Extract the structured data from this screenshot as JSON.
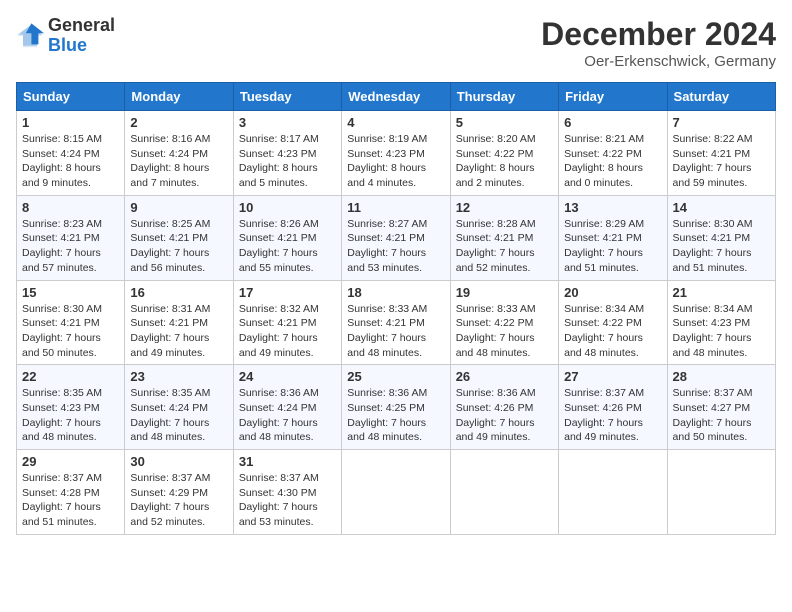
{
  "logo": {
    "general": "General",
    "blue": "Blue"
  },
  "title": "December 2024",
  "subtitle": "Oer-Erkenschwick, Germany",
  "headers": [
    "Sunday",
    "Monday",
    "Tuesday",
    "Wednesday",
    "Thursday",
    "Friday",
    "Saturday"
  ],
  "weeks": [
    [
      {
        "day": "1",
        "info": "Sunrise: 8:15 AM\nSunset: 4:24 PM\nDaylight: 8 hours and 9 minutes."
      },
      {
        "day": "2",
        "info": "Sunrise: 8:16 AM\nSunset: 4:24 PM\nDaylight: 8 hours and 7 minutes."
      },
      {
        "day": "3",
        "info": "Sunrise: 8:17 AM\nSunset: 4:23 PM\nDaylight: 8 hours and 5 minutes."
      },
      {
        "day": "4",
        "info": "Sunrise: 8:19 AM\nSunset: 4:23 PM\nDaylight: 8 hours and 4 minutes."
      },
      {
        "day": "5",
        "info": "Sunrise: 8:20 AM\nSunset: 4:22 PM\nDaylight: 8 hours and 2 minutes."
      },
      {
        "day": "6",
        "info": "Sunrise: 8:21 AM\nSunset: 4:22 PM\nDaylight: 8 hours and 0 minutes."
      },
      {
        "day": "7",
        "info": "Sunrise: 8:22 AM\nSunset: 4:21 PM\nDaylight: 7 hours and 59 minutes."
      }
    ],
    [
      {
        "day": "8",
        "info": "Sunrise: 8:23 AM\nSunset: 4:21 PM\nDaylight: 7 hours and 57 minutes."
      },
      {
        "day": "9",
        "info": "Sunrise: 8:25 AM\nSunset: 4:21 PM\nDaylight: 7 hours and 56 minutes."
      },
      {
        "day": "10",
        "info": "Sunrise: 8:26 AM\nSunset: 4:21 PM\nDaylight: 7 hours and 55 minutes."
      },
      {
        "day": "11",
        "info": "Sunrise: 8:27 AM\nSunset: 4:21 PM\nDaylight: 7 hours and 53 minutes."
      },
      {
        "day": "12",
        "info": "Sunrise: 8:28 AM\nSunset: 4:21 PM\nDaylight: 7 hours and 52 minutes."
      },
      {
        "day": "13",
        "info": "Sunrise: 8:29 AM\nSunset: 4:21 PM\nDaylight: 7 hours and 51 minutes."
      },
      {
        "day": "14",
        "info": "Sunrise: 8:30 AM\nSunset: 4:21 PM\nDaylight: 7 hours and 51 minutes."
      }
    ],
    [
      {
        "day": "15",
        "info": "Sunrise: 8:30 AM\nSunset: 4:21 PM\nDaylight: 7 hours and 50 minutes."
      },
      {
        "day": "16",
        "info": "Sunrise: 8:31 AM\nSunset: 4:21 PM\nDaylight: 7 hours and 49 minutes."
      },
      {
        "day": "17",
        "info": "Sunrise: 8:32 AM\nSunset: 4:21 PM\nDaylight: 7 hours and 49 minutes."
      },
      {
        "day": "18",
        "info": "Sunrise: 8:33 AM\nSunset: 4:21 PM\nDaylight: 7 hours and 48 minutes."
      },
      {
        "day": "19",
        "info": "Sunrise: 8:33 AM\nSunset: 4:22 PM\nDaylight: 7 hours and 48 minutes."
      },
      {
        "day": "20",
        "info": "Sunrise: 8:34 AM\nSunset: 4:22 PM\nDaylight: 7 hours and 48 minutes."
      },
      {
        "day": "21",
        "info": "Sunrise: 8:34 AM\nSunset: 4:23 PM\nDaylight: 7 hours and 48 minutes."
      }
    ],
    [
      {
        "day": "22",
        "info": "Sunrise: 8:35 AM\nSunset: 4:23 PM\nDaylight: 7 hours and 48 minutes."
      },
      {
        "day": "23",
        "info": "Sunrise: 8:35 AM\nSunset: 4:24 PM\nDaylight: 7 hours and 48 minutes."
      },
      {
        "day": "24",
        "info": "Sunrise: 8:36 AM\nSunset: 4:24 PM\nDaylight: 7 hours and 48 minutes."
      },
      {
        "day": "25",
        "info": "Sunrise: 8:36 AM\nSunset: 4:25 PM\nDaylight: 7 hours and 48 minutes."
      },
      {
        "day": "26",
        "info": "Sunrise: 8:36 AM\nSunset: 4:26 PM\nDaylight: 7 hours and 49 minutes."
      },
      {
        "day": "27",
        "info": "Sunrise: 8:37 AM\nSunset: 4:26 PM\nDaylight: 7 hours and 49 minutes."
      },
      {
        "day": "28",
        "info": "Sunrise: 8:37 AM\nSunset: 4:27 PM\nDaylight: 7 hours and 50 minutes."
      }
    ],
    [
      {
        "day": "29",
        "info": "Sunrise: 8:37 AM\nSunset: 4:28 PM\nDaylight: 7 hours and 51 minutes."
      },
      {
        "day": "30",
        "info": "Sunrise: 8:37 AM\nSunset: 4:29 PM\nDaylight: 7 hours and 52 minutes."
      },
      {
        "day": "31",
        "info": "Sunrise: 8:37 AM\nSunset: 4:30 PM\nDaylight: 7 hours and 53 minutes."
      },
      null,
      null,
      null,
      null
    ]
  ]
}
